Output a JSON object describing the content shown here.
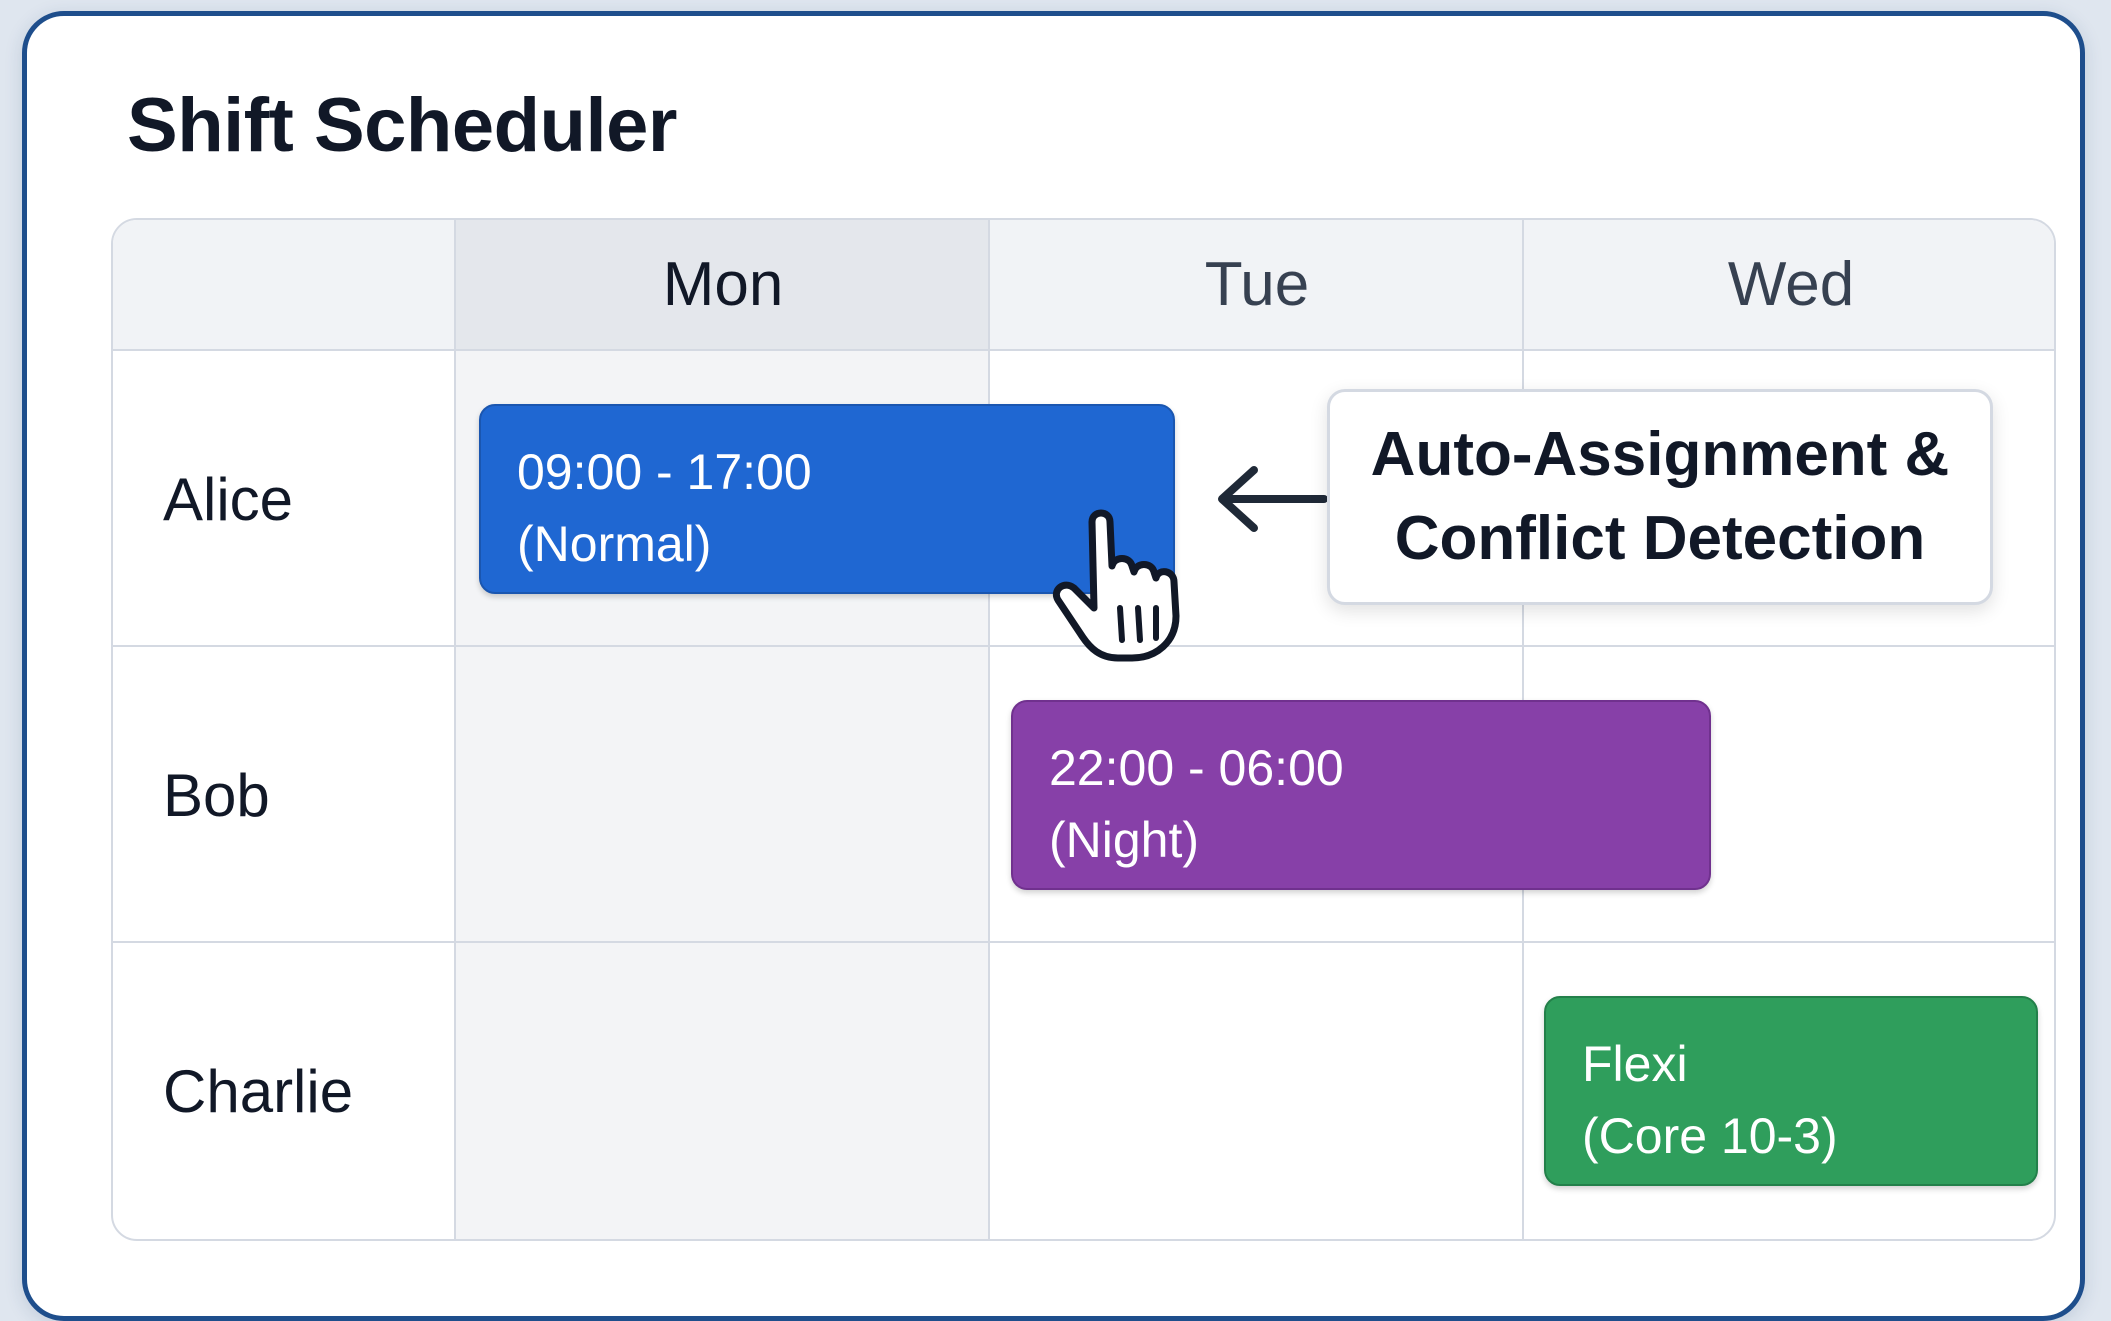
{
  "app": {
    "title": "Shift Scheduler"
  },
  "schedule": {
    "days": [
      {
        "label": "Mon",
        "active": true
      },
      {
        "label": "Tue",
        "active": false
      },
      {
        "label": "Wed",
        "active": false
      }
    ],
    "employees": [
      {
        "name": "Alice"
      },
      {
        "name": "Bob"
      },
      {
        "name": "Charlie"
      }
    ],
    "shifts": [
      {
        "employee": "Alice",
        "type": "normal",
        "line1": "09:00 - 17:00",
        "line2": "(Normal)",
        "color": "#1f67d2"
      },
      {
        "employee": "Bob",
        "type": "night",
        "line1": "22:00 - 06:00",
        "line2": "(Night)",
        "color": "#8740a8"
      },
      {
        "employee": "Charlie",
        "type": "flexi",
        "line1": "Flexi",
        "line2": "(Core 10-3)",
        "color": "#2f9e5c"
      }
    ]
  },
  "callout": {
    "line1": "Auto-Assignment &",
    "line2": "Conflict Detection"
  },
  "icons": {
    "arrow": "arrow-left-icon",
    "cursor": "hand-pointer-icon"
  },
  "colors": {
    "frame_border": "#1e4e8c",
    "grid_border": "#d4d9e2",
    "header_bg": "#f1f3f6"
  }
}
